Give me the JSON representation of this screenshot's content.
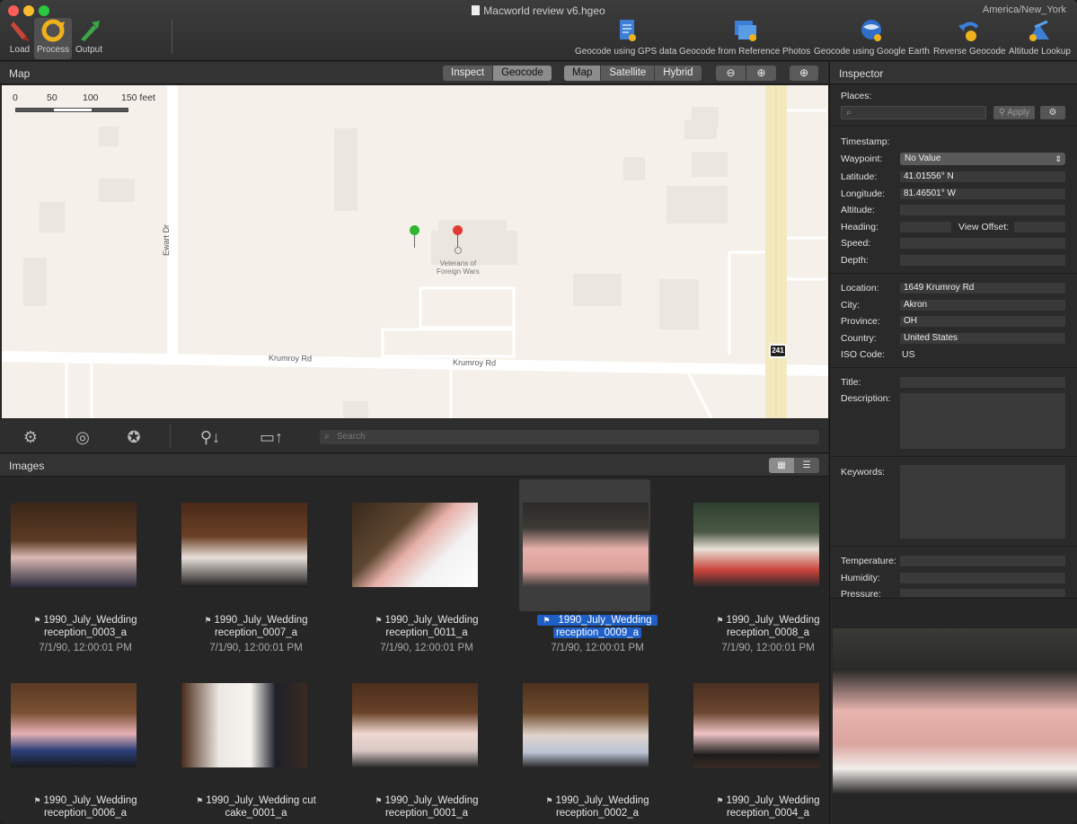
{
  "window": {
    "title": "Macworld review v6.hgeo",
    "timezone": "America/New_York"
  },
  "toolbar": {
    "left": [
      {
        "label": "Load",
        "icon": "load-icon"
      },
      {
        "label": "Process",
        "icon": "process-icon"
      },
      {
        "label": "Output",
        "icon": "output-icon"
      }
    ],
    "right": [
      {
        "label": "Geocode using GPS data",
        "icon": "gps-data-icon"
      },
      {
        "label": "Geocode from Reference Photos",
        "icon": "reference-photos-icon"
      },
      {
        "label": "Geocode using Google Earth",
        "icon": "google-earth-icon"
      },
      {
        "label": "Reverse Geocode",
        "icon": "reverse-geocode-icon"
      },
      {
        "label": "Altitude Lookup",
        "icon": "altitude-lookup-icon"
      }
    ]
  },
  "map_panel": {
    "title": "Map",
    "mode_tabs": [
      "Inspect",
      "Geocode"
    ],
    "selected_mode": "Geocode",
    "map_types": [
      "Map",
      "Satellite",
      "Hybrid"
    ],
    "selected_map_type": "Map",
    "scale": {
      "labels": [
        "0",
        "50",
        "100",
        "150 feet"
      ]
    },
    "labels": {
      "ewart": "Ewart Dr",
      "krumroy_left": "Krumroy Rd",
      "krumroy_right": "Krumroy Rd",
      "vfw_line1": "Veterans of",
      "vfw_line2": "Foreign Wars",
      "route": "241"
    },
    "search_placeholder": "Search"
  },
  "images_panel": {
    "title": "Images",
    "items": [
      {
        "name_line1": "1990_July_Wedding",
        "name_line2": "reception_0003_a",
        "date": "7/1/90, 12:00:01 PM",
        "selected": false
      },
      {
        "name_line1": "1990_July_Wedding",
        "name_line2": "reception_0007_a",
        "date": "7/1/90, 12:00:01 PM",
        "selected": false
      },
      {
        "name_line1": "1990_July_Wedding",
        "name_line2": "reception_0011_a",
        "date": "7/1/90, 12:00:01 PM",
        "selected": false
      },
      {
        "name_line1": "1990_July_Wedding",
        "name_line2": "reception_0009_a",
        "date": "7/1/90, 12:00:01 PM",
        "selected": true
      },
      {
        "name_line1": "1990_July_Wedding",
        "name_line2": "reception_0008_a",
        "date": "7/1/90, 12:00:01 PM",
        "selected": false
      },
      {
        "name_line1": "1990_July_Wedding",
        "name_line2": "reception_0006_a",
        "date": "",
        "selected": false
      },
      {
        "name_line1": "1990_July_Wedding cut",
        "name_line2": "cake_0001_a",
        "date": "",
        "selected": false
      },
      {
        "name_line1": "1990_July_Wedding",
        "name_line2": "reception_0001_a",
        "date": "",
        "selected": false
      },
      {
        "name_line1": "1990_July_Wedding",
        "name_line2": "reception_0002_a",
        "date": "",
        "selected": false
      },
      {
        "name_line1": "1990_July_Wedding",
        "name_line2": "reception_0004_a",
        "date": "",
        "selected": false
      }
    ]
  },
  "inspector": {
    "title": "Inspector",
    "places_label": "Places:",
    "apply_label": "Apply",
    "timestamp_label": "Timestamp:",
    "waypoint_label": "Waypoint:",
    "waypoint_value": "No Value",
    "latitude_label": "Latitude:",
    "latitude_value": "41.01556° N",
    "longitude_label": "Longitude:",
    "longitude_value": "81.46501° W",
    "altitude_label": "Altitude:",
    "heading_label": "Heading:",
    "view_offset_label": "View Offset:",
    "speed_label": "Speed:",
    "depth_label": "Depth:",
    "location_label": "Location:",
    "location_value": "1649 Krumroy Rd",
    "city_label": "City:",
    "city_value": "Akron",
    "province_label": "Province:",
    "province_value": "OH",
    "country_label": "Country:",
    "country_value": "United States",
    "iso_label": "ISO Code:",
    "iso_value": "US",
    "title_label": "Title:",
    "description_label": "Description:",
    "keywords_label": "Keywords:",
    "temperature_label": "Temperature:",
    "humidity_label": "Humidity:",
    "pressure_label": "Pressure:"
  },
  "colors": {
    "selection": "#1f5fc8",
    "map_bg": "#f5f1ea",
    "pin_green": "#2fb52f",
    "pin_red": "#e23a32"
  }
}
